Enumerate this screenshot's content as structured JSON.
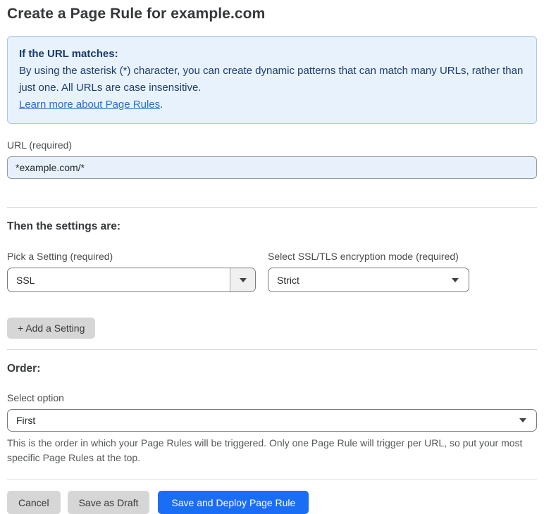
{
  "page": {
    "title": "Create a Page Rule for example.com"
  },
  "info_box": {
    "heading": "If the URL matches:",
    "body": "By using the asterisk (*) character, you can create dynamic patterns that can match many URLs, rather than just one. All URLs are case insensitive.",
    "link_label": "Learn more about Page Rules",
    "link_suffix": "."
  },
  "url_field": {
    "label": "URL (required)",
    "value": "*example.com/*"
  },
  "settings_section": {
    "heading": "Then the settings are:",
    "pick_setting": {
      "label": "Pick a Setting (required)",
      "value": "SSL"
    },
    "ssl_mode": {
      "label": "Select SSL/TLS encryption mode (required)",
      "value": "Strict"
    },
    "add_setting_label": "+ Add a Setting"
  },
  "order_section": {
    "heading": "Order:",
    "select_label": "Select option",
    "value": "First",
    "help_text": "This is the order in which your Page Rules will be triggered. Only one Page Rule will trigger per URL, so put your most specific Page Rules at the top."
  },
  "footer": {
    "cancel_label": "Cancel",
    "save_draft_label": "Save as Draft",
    "save_deploy_label": "Save and Deploy Page Rule"
  },
  "colors": {
    "accent_blue": "#1a6ef5",
    "info_bg": "#e8f2fc",
    "info_text": "#1c3c6e",
    "link_blue": "#2c6ccb",
    "input_bg": "#e8f0fb"
  }
}
